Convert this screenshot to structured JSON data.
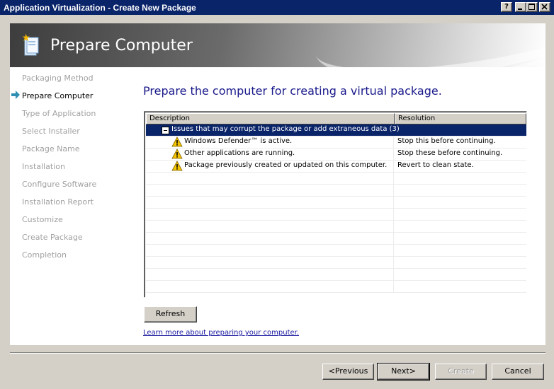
{
  "window": {
    "title": "Application Virtualization - Create New Package",
    "help_label": "?",
    "min_label": "_",
    "max_label": "□",
    "close_label": "✕"
  },
  "banner": {
    "title": "Prepare Computer",
    "icon": "package-wizard-icon"
  },
  "steps": [
    {
      "label": "Packaging Method",
      "active": false
    },
    {
      "label": "Prepare Computer",
      "active": true
    },
    {
      "label": "Type of Application",
      "active": false
    },
    {
      "label": "Select Installer",
      "active": false
    },
    {
      "label": "Package Name",
      "active": false
    },
    {
      "label": "Installation",
      "active": false
    },
    {
      "label": "Configure Software",
      "active": false
    },
    {
      "label": "Installation Report",
      "active": false
    },
    {
      "label": "Customize",
      "active": false
    },
    {
      "label": "Create Package",
      "active": false
    },
    {
      "label": "Completion",
      "active": false
    }
  ],
  "main": {
    "heading": "Prepare the computer for creating a virtual package.",
    "list": {
      "columns": [
        "Description",
        "Resolution"
      ],
      "group": "Issues that may corrupt the package or add extraneous data (3)",
      "rows": [
        {
          "description": "Windows Defender™ is active.",
          "resolution": "Stop this before continuing.",
          "icon": "warning-icon"
        },
        {
          "description": "Other applications are running.",
          "resolution": "Stop these before continuing.",
          "icon": "warning-icon"
        },
        {
          "description": "Package previously created or updated on this computer.",
          "resolution": "Revert to clean state.",
          "icon": "warning-icon"
        }
      ]
    },
    "refresh_label": "Refresh",
    "learn_more": "Learn more about preparing your computer."
  },
  "footer": {
    "previous_label": "<Previous",
    "next_label": "Next>",
    "create_label": "Create",
    "cancel_label": "Cancel"
  },
  "colors": {
    "titlebar": "#0a246a",
    "heading": "#1a1a8c",
    "selection": "#0a246a",
    "warning": "#f5c400"
  }
}
